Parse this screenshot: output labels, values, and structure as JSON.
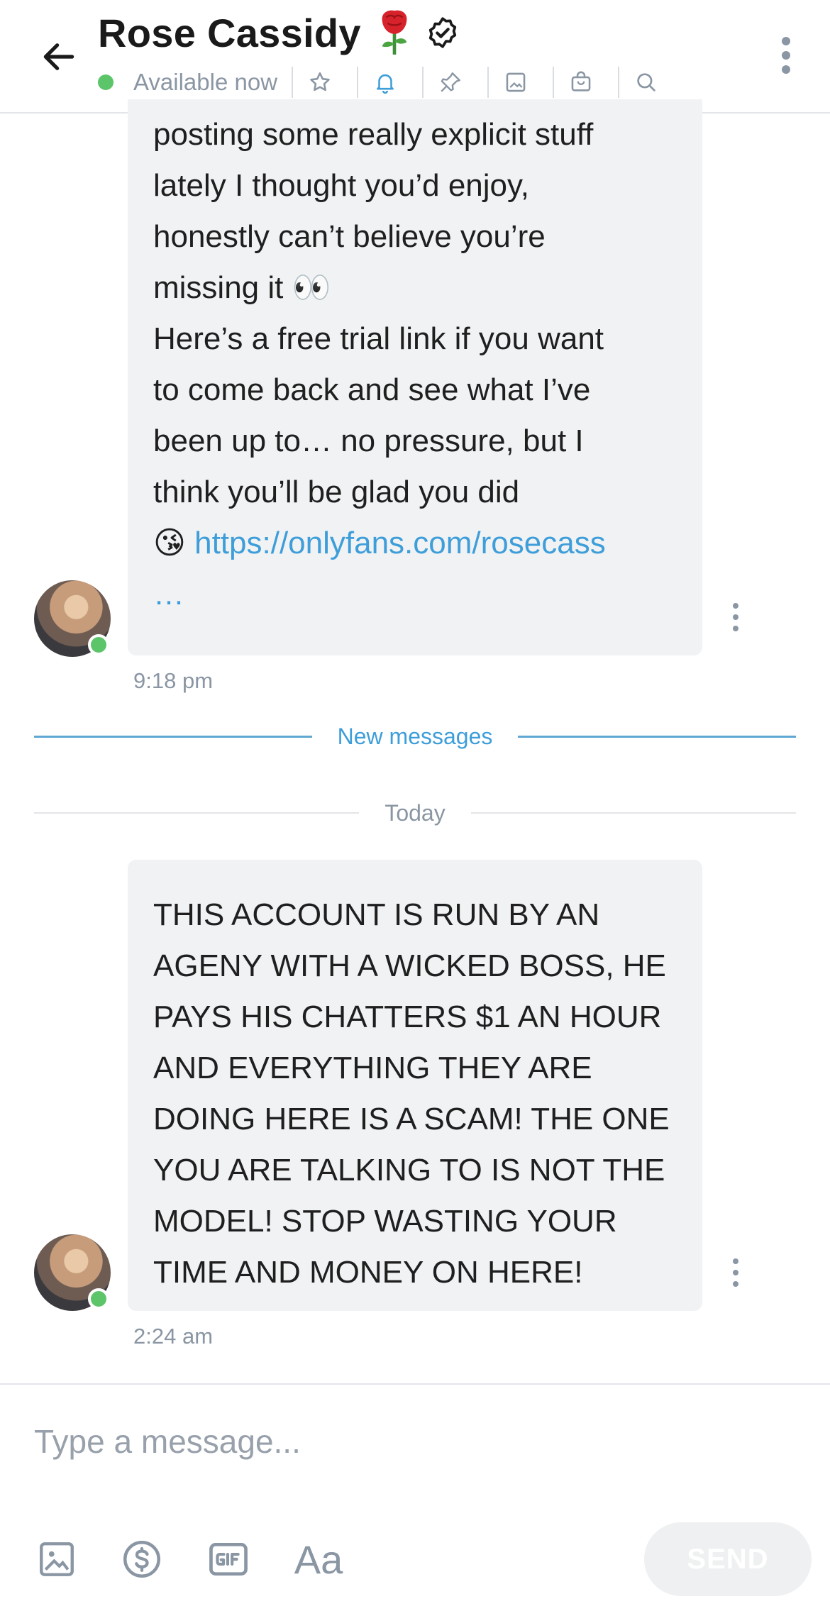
{
  "header": {
    "title": "Rose Cassidy",
    "status": "Available now",
    "colors": {
      "online": "#5cc569",
      "muted": "#8a96a3",
      "accent": "#3e9ed9"
    },
    "icons": [
      "back-arrow-icon",
      "rose-icon",
      "verified-icon",
      "star-icon",
      "bell-icon",
      "pin-icon",
      "image-icon",
      "bag-icon",
      "search-icon",
      "more-vertical-icon"
    ]
  },
  "messages": [
    {
      "lines": [
        "posting some really explicit stuff",
        "lately I thought you’d enjoy,",
        "honestly can’t believe you’re",
        "missing it 👀",
        "Here’s a free trial link if you want",
        "to come back and see what I’ve",
        "been up to… no pressure, but I",
        "think you’ll be glad you did"
      ],
      "link_emoji": "😘",
      "link_text": "https://onlyfans.com/rosecass",
      "link_more": "…",
      "time": "9:18 pm"
    },
    {
      "lines": [
        "THIS ACCOUNT IS RUN BY AN",
        "AGENY WITH A WICKED BOSS, HE",
        "PAYS HIS CHATTERS $1 AN HOUR",
        "AND EVERYTHING THEY ARE",
        "DOING HERE IS A SCAM! THE ONE",
        "YOU ARE TALKING TO IS NOT THE",
        "MODEL! STOP WASTING YOUR",
        "TIME AND MONEY ON HERE!"
      ],
      "time": "2:24 am"
    }
  ],
  "dividers": {
    "new_messages": "New messages",
    "today": "Today"
  },
  "composer": {
    "placeholder": "Type a message...",
    "text_format_label": "Aa",
    "send_label": "SEND",
    "icons": [
      "image-icon",
      "dollar-icon",
      "gif-icon",
      "text-format-icon"
    ]
  }
}
